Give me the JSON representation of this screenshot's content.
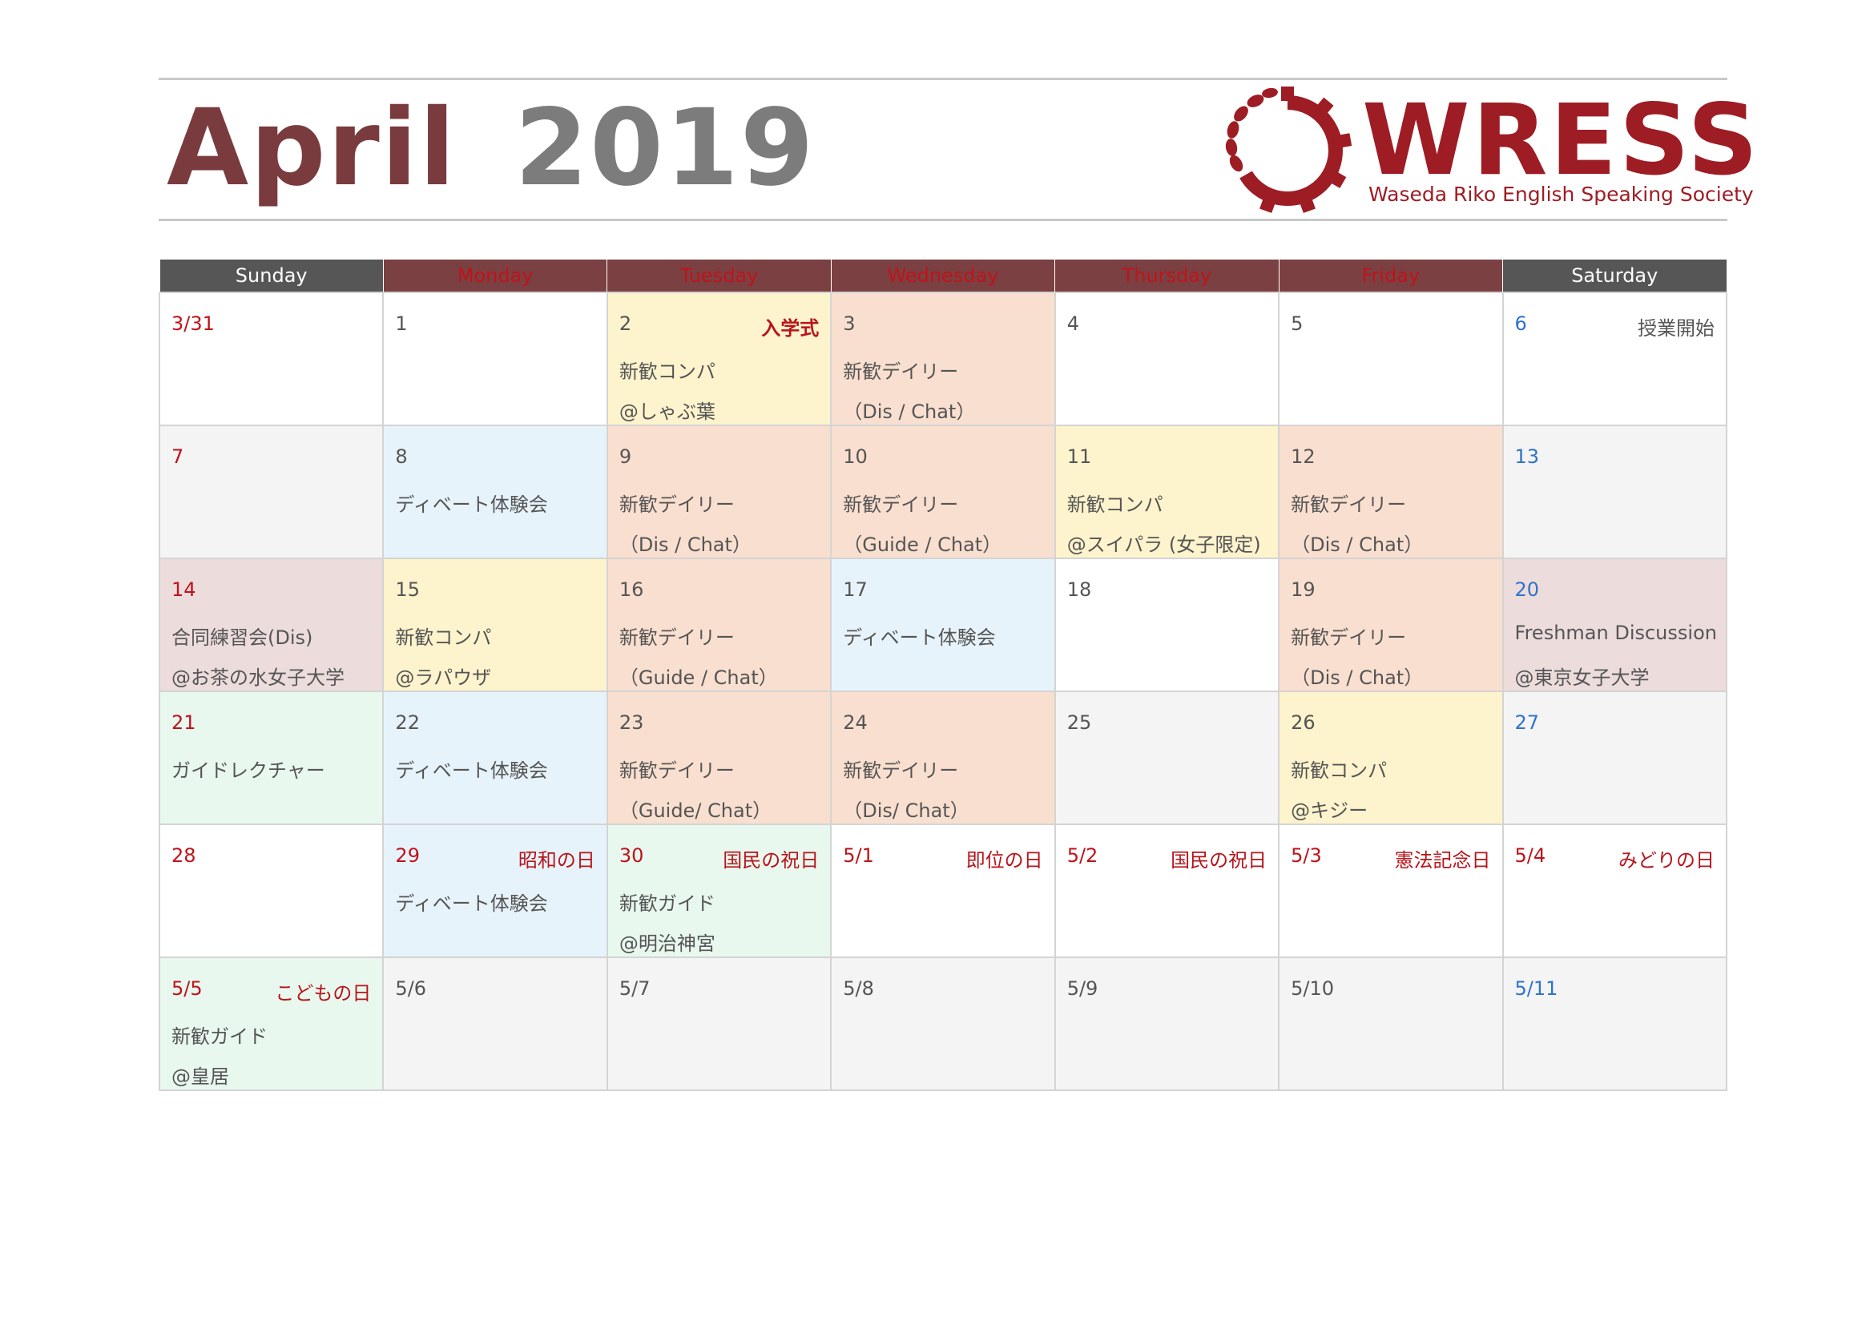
{
  "header": {
    "month": "April",
    "year": "2019",
    "logo_text": "WRESS",
    "logo_subtitle": "Waseda Riko English Speaking Society"
  },
  "colors": {
    "brand": "#9e1c24",
    "header_dark": "#565656",
    "header_red": "#7b4042",
    "holiday": "#c0131a",
    "saturday": "#2e74c9"
  },
  "weekdays": [
    "Sunday",
    "Monday",
    "Tuesday",
    "Wednesday",
    "Thursday",
    "Friday",
    "Saturday"
  ],
  "weeks": [
    [
      {
        "date": "3/31",
        "holiday": "",
        "line1": "",
        "line2": ""
      },
      {
        "date": "1",
        "holiday": "",
        "line1": "",
        "line2": ""
      },
      {
        "date": "2",
        "holiday": "入学式",
        "line1": "新歓コンパ",
        "line2": "@しゃぶ葉"
      },
      {
        "date": "3",
        "holiday": "",
        "line1": "新歓デイリー",
        "line2": "（Dis / Chat）"
      },
      {
        "date": "4",
        "holiday": "",
        "line1": "",
        "line2": ""
      },
      {
        "date": "5",
        "holiday": "",
        "line1": "",
        "line2": ""
      },
      {
        "date": "6",
        "holiday": "授業開始",
        "line1": "",
        "line2": ""
      }
    ],
    [
      {
        "date": "7",
        "holiday": "",
        "line1": "",
        "line2": ""
      },
      {
        "date": "8",
        "holiday": "",
        "line1": "ディベート体験会",
        "line2": ""
      },
      {
        "date": "9",
        "holiday": "",
        "line1": "新歓デイリー",
        "line2": "（Dis / Chat）"
      },
      {
        "date": "10",
        "holiday": "",
        "line1": "新歓デイリー",
        "line2": "（Guide / Chat）"
      },
      {
        "date": "11",
        "holiday": "",
        "line1": "新歓コンパ",
        "line2": "@スイパラ (女子限定)"
      },
      {
        "date": "12",
        "holiday": "",
        "line1": "新歓デイリー",
        "line2": "（Dis / Chat）"
      },
      {
        "date": "13",
        "holiday": "",
        "line1": "",
        "line2": ""
      }
    ],
    [
      {
        "date": "14",
        "holiday": "",
        "line1": "合同練習会(Dis)",
        "line2": "@お茶の水女子大学"
      },
      {
        "date": "15",
        "holiday": "",
        "line1": "新歓コンパ",
        "line2": "@ラパウザ"
      },
      {
        "date": "16",
        "holiday": "",
        "line1": "新歓デイリー",
        "line2": "（Guide / Chat）"
      },
      {
        "date": "17",
        "holiday": "",
        "line1": "ディベート体験会",
        "line2": ""
      },
      {
        "date": "18",
        "holiday": "",
        "line1": "",
        "line2": ""
      },
      {
        "date": "19",
        "holiday": "",
        "line1": "新歓デイリー",
        "line2": "（Dis / Chat）"
      },
      {
        "date": "20",
        "holiday": "",
        "line1": "Freshman Discussion",
        "line2": "@東京女子大学"
      }
    ],
    [
      {
        "date": "21",
        "holiday": "",
        "line1": "ガイドレクチャー",
        "line2": ""
      },
      {
        "date": "22",
        "holiday": "",
        "line1": "ディベート体験会",
        "line2": ""
      },
      {
        "date": "23",
        "holiday": "",
        "line1": "新歓デイリー",
        "line2": "（Guide/ Chat）"
      },
      {
        "date": "24",
        "holiday": "",
        "line1": "新歓デイリー",
        "line2": "（Dis/ Chat）"
      },
      {
        "date": "25",
        "holiday": "",
        "line1": "",
        "line2": ""
      },
      {
        "date": "26",
        "holiday": "",
        "line1": "新歓コンパ",
        "line2": "@キジー"
      },
      {
        "date": "27",
        "holiday": "",
        "line1": "",
        "line2": ""
      }
    ],
    [
      {
        "date": "28",
        "holiday": "",
        "line1": "",
        "line2": ""
      },
      {
        "date": "29",
        "holiday": "昭和の日",
        "line1": "ディベート体験会",
        "line2": ""
      },
      {
        "date": "30",
        "holiday": "国民の祝日",
        "line1": "新歓ガイド",
        "line2": "@明治神宮"
      },
      {
        "date": "5/1",
        "holiday": "即位の日",
        "line1": "",
        "line2": ""
      },
      {
        "date": "5/2",
        "holiday": "国民の祝日",
        "line1": "",
        "line2": ""
      },
      {
        "date": "5/3",
        "holiday": "憲法記念日",
        "line1": "",
        "line2": ""
      },
      {
        "date": "5/4",
        "holiday": "みどりの日",
        "line1": "",
        "line2": ""
      }
    ],
    [
      {
        "date": "5/5",
        "holiday": "こどもの日",
        "line1": "新歓ガイド",
        "line2": "@皇居"
      },
      {
        "date": "5/6",
        "holiday": "",
        "line1": "",
        "line2": ""
      },
      {
        "date": "5/7",
        "holiday": "",
        "line1": "",
        "line2": ""
      },
      {
        "date": "5/8",
        "holiday": "",
        "line1": "",
        "line2": ""
      },
      {
        "date": "5/9",
        "holiday": "",
        "line1": "",
        "line2": ""
      },
      {
        "date": "5/10",
        "holiday": "",
        "line1": "",
        "line2": ""
      },
      {
        "date": "5/11",
        "holiday": "",
        "line1": "",
        "line2": ""
      }
    ]
  ]
}
